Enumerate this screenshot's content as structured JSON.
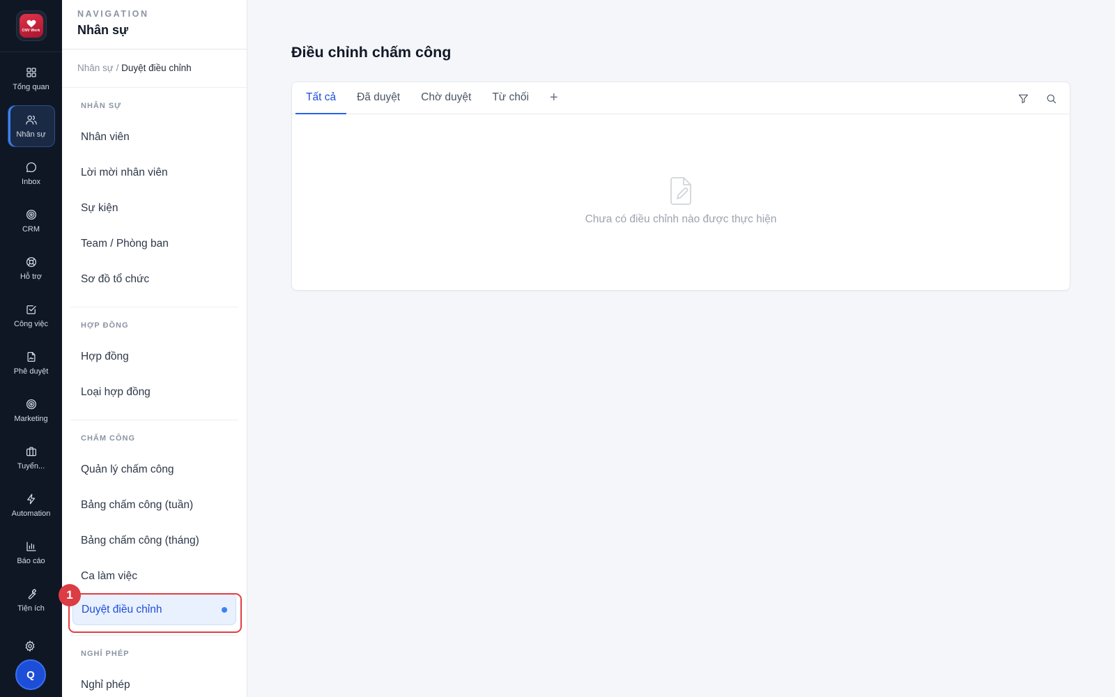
{
  "app": {
    "logo_text": "CNV Work",
    "avatar_initial": "Q"
  },
  "rail": {
    "items": [
      {
        "label": "Tổng quan",
        "icon": "grid-icon"
      },
      {
        "label": "Nhân sự",
        "icon": "users-icon"
      },
      {
        "label": "Inbox",
        "icon": "chat-icon"
      },
      {
        "label": "CRM",
        "icon": "target-icon"
      },
      {
        "label": "Hỗ trợ",
        "icon": "lifebuoy-icon"
      },
      {
        "label": "Công việc",
        "icon": "checkbox-icon"
      },
      {
        "label": "Phê duyệt",
        "icon": "file-sign-icon"
      },
      {
        "label": "Marketing",
        "icon": "target-icon"
      },
      {
        "label": "Tuyển...",
        "icon": "briefcase-icon"
      },
      {
        "label": "Automation",
        "icon": "bolt-icon"
      },
      {
        "label": "Báo cáo",
        "icon": "bar-chart-icon"
      },
      {
        "label": "Tiện ích",
        "icon": "wrench-icon"
      }
    ],
    "active_index": 1
  },
  "nav": {
    "kicker": "NAVIGATION",
    "title": "Nhân sự",
    "breadcrumb": {
      "parent": "Nhân sự",
      "separator": " / ",
      "current": "Duyệt điều chỉnh"
    },
    "sections": [
      {
        "label": "NHÂN SỰ",
        "items": [
          "Nhân viên",
          "Lời mời nhân viên",
          "Sự kiện",
          "Team / Phòng ban",
          "Sơ đồ tổ chức"
        ]
      },
      {
        "label": "HỢP ĐỒNG",
        "items": [
          "Hợp đồng",
          "Loại hợp đồng"
        ]
      },
      {
        "label": "CHẤM CÔNG",
        "items": [
          "Quản lý chấm công",
          "Bảng chấm công (tuần)",
          "Bảng chấm công (tháng)",
          "Ca làm việc",
          "Duyệt điều chỉnh"
        ]
      },
      {
        "label": "NGHỈ PHÉP",
        "items": [
          "Nghỉ phép"
        ]
      }
    ],
    "active_item": "Duyệt điều chỉnh",
    "marker_label": "1"
  },
  "main": {
    "title": "Điều chỉnh chấm công",
    "tabs": [
      "Tất cả",
      "Đã duyệt",
      "Chờ duyệt",
      "Từ chối"
    ],
    "active_tab": 0,
    "add_tab_symbol": "+",
    "empty_text": "Chưa có điều chỉnh nào được thực hiện"
  },
  "colors": {
    "rail_bg": "#0f1725",
    "accent": "#2563eb",
    "highlight_border": "#e23d44",
    "page_bg": "#f5f6f9"
  }
}
